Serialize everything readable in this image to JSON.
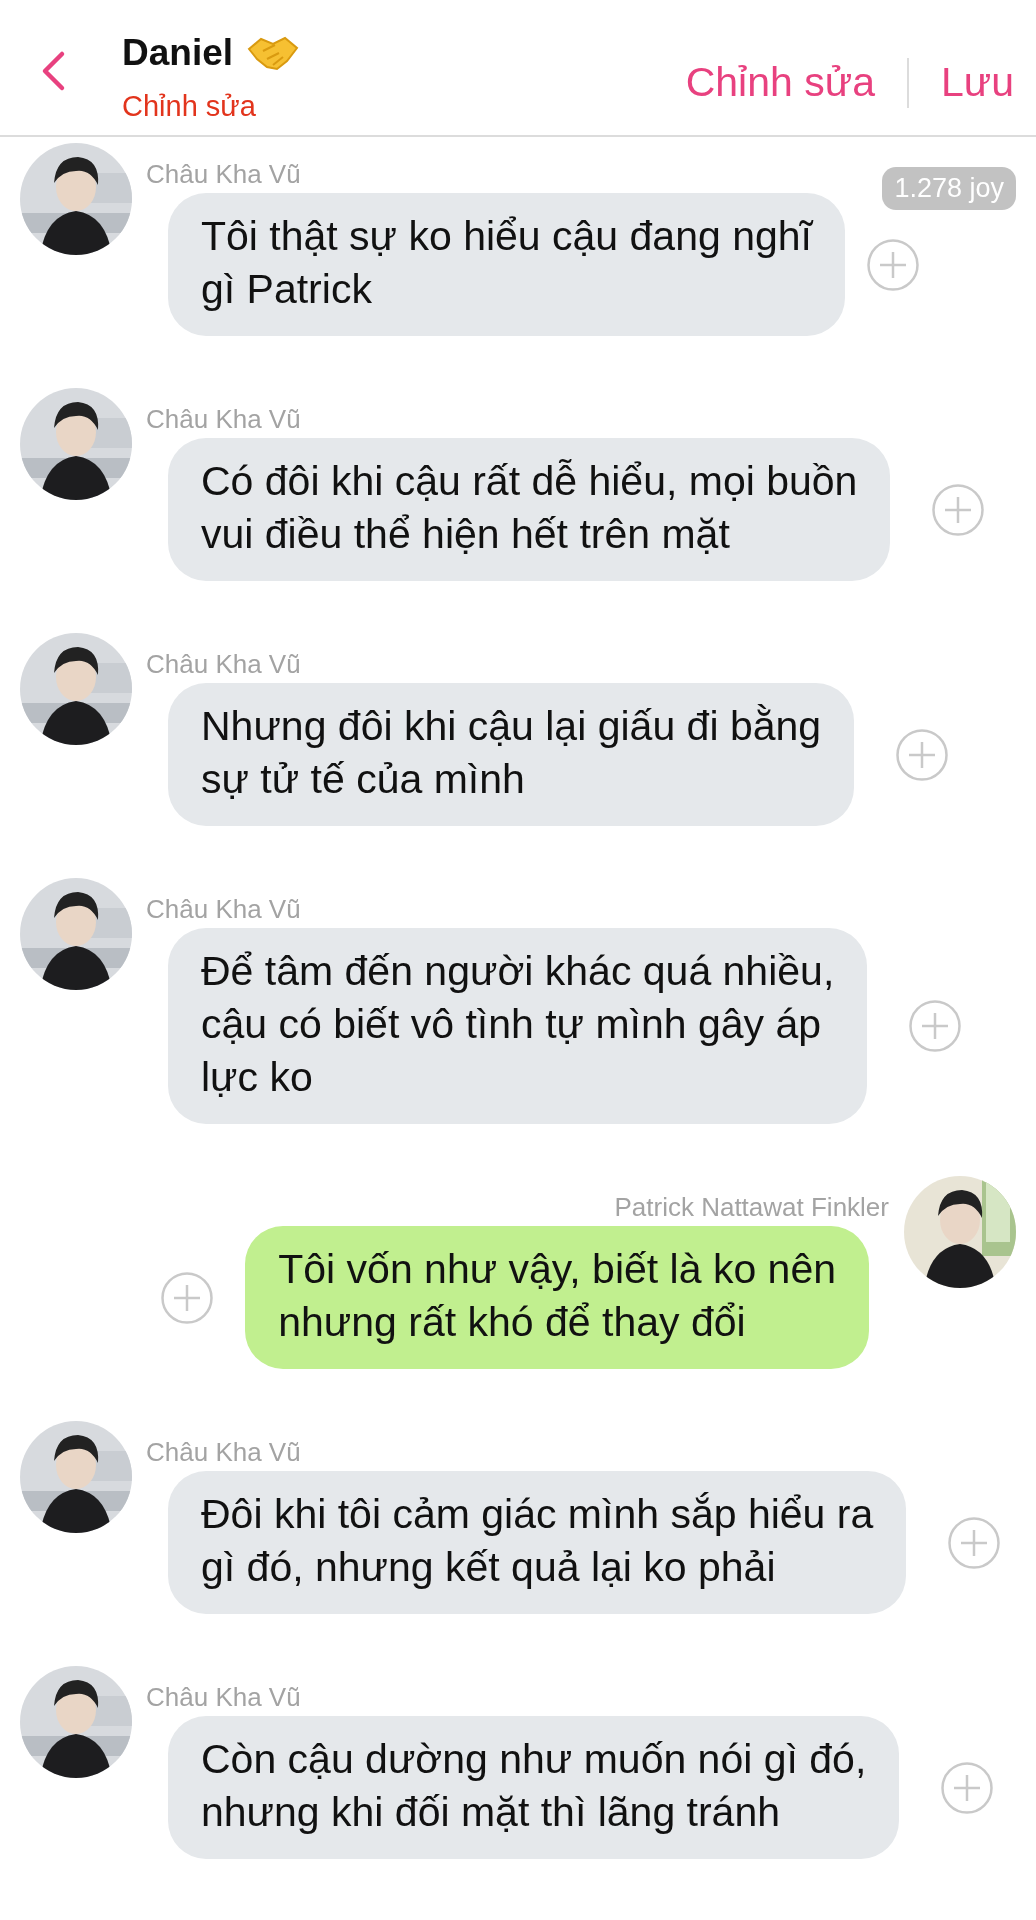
{
  "header": {
    "title": "Daniel",
    "subtitle": "Chỉnh sửa",
    "actions": [
      "Chỉnh sửa",
      "Lưu"
    ]
  },
  "messages": [
    {
      "kind": "incoming",
      "sender": "Châu Kha Vũ",
      "lines": [
        "Tôi thật sự ko hiểu cậu đang nghĩ",
        "gì Patrick"
      ],
      "badge": "1.278 joy"
    },
    {
      "kind": "incoming",
      "sender": "Châu Kha Vũ",
      "lines": [
        "Có đôi khi cậu rất dễ hiểu, mọi buồn",
        "vui điều thể hiện hết trên mặt"
      ]
    },
    {
      "kind": "incoming",
      "sender": "Châu Kha Vũ",
      "lines": [
        "Nhưng đôi khi cậu lại giấu đi bằng",
        "sự tử tế của mình"
      ]
    },
    {
      "kind": "incoming",
      "sender": "Châu Kha Vũ",
      "lines": [
        "Để tâm đến người khác quá nhiều,",
        "cậu có biết vô tình tự mình gây áp",
        "lực ko"
      ]
    },
    {
      "kind": "outgoing",
      "sender": "Patrick Nattawat Finkler",
      "lines": [
        "Tôi vốn như vậy, biết là ko nên",
        "nhưng rất khó để thay đổi"
      ]
    },
    {
      "kind": "incoming",
      "sender": "Châu Kha Vũ",
      "lines": [
        "Đôi khi tôi cảm giác mình sắp hiểu ra",
        "gì đó, nhưng kết quả lại ko phải"
      ]
    },
    {
      "kind": "incoming",
      "sender": "Châu Kha Vũ",
      "lines": [
        "Còn cậu dường như muốn nói gì đó,",
        "nhưng khi đối mặt thì lãng tránh"
      ]
    }
  ]
}
